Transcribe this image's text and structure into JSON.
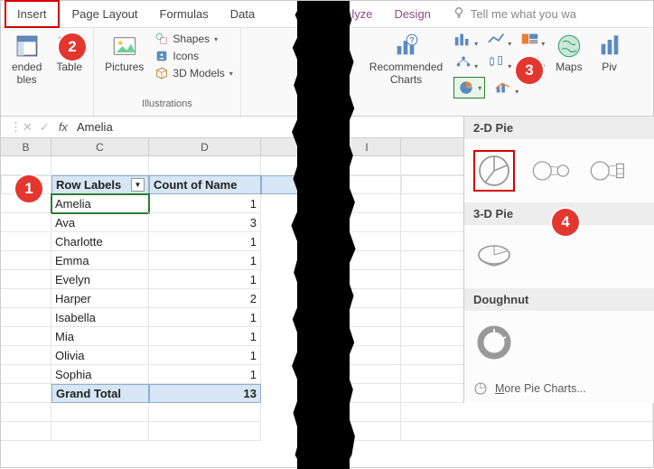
{
  "tabs": {
    "insert": "Insert",
    "page_layout": "Page Layout",
    "formulas": "Formulas",
    "data": "Data",
    "analyze": "Analyze",
    "design": "Design",
    "tell_me": "Tell me what you wa"
  },
  "ribbon": {
    "tables": {
      "recommended_pivot_1": "ended",
      "recommended_pivot_2": "bles",
      "table": "Table"
    },
    "illustrations": {
      "pictures": "Pictures",
      "shapes": "Shapes",
      "icons": "Icons",
      "models": "3D Models",
      "group_label": "Illustrations"
    },
    "charts": {
      "recommended_1": "Recommended",
      "recommended_2": "Charts",
      "maps": "Maps",
      "pivot": "Piv"
    }
  },
  "formula_bar": {
    "value": "Amelia",
    "cancel": "✕",
    "enter": "✓",
    "fx": "fx"
  },
  "grid": {
    "columns": {
      "B": "B",
      "C": "C",
      "D": "D",
      "I": "I"
    },
    "header": {
      "row_labels": "Row Labels",
      "count": "Count of Name"
    },
    "rows": [
      {
        "name": "Amelia",
        "count": 1
      },
      {
        "name": "Ava",
        "count": 3
      },
      {
        "name": "Charlotte",
        "count": 1
      },
      {
        "name": "Emma",
        "count": 1
      },
      {
        "name": "Evelyn",
        "count": 1
      },
      {
        "name": "Harper",
        "count": 2
      },
      {
        "name": "Isabella",
        "count": 1
      },
      {
        "name": "Mia",
        "count": 1
      },
      {
        "name": "Olivia",
        "count": 1
      },
      {
        "name": "Sophia",
        "count": 1
      }
    ],
    "total": {
      "label": "Grand Total",
      "count": 13
    }
  },
  "chart_panel": {
    "pie2d": "2-D Pie",
    "pie3d": "3-D Pie",
    "doughnut": "Doughnut",
    "more": "More Pie Charts...",
    "more_prefix": "M"
  },
  "badges": {
    "1": "1",
    "2": "2",
    "3": "3",
    "4": "4"
  }
}
